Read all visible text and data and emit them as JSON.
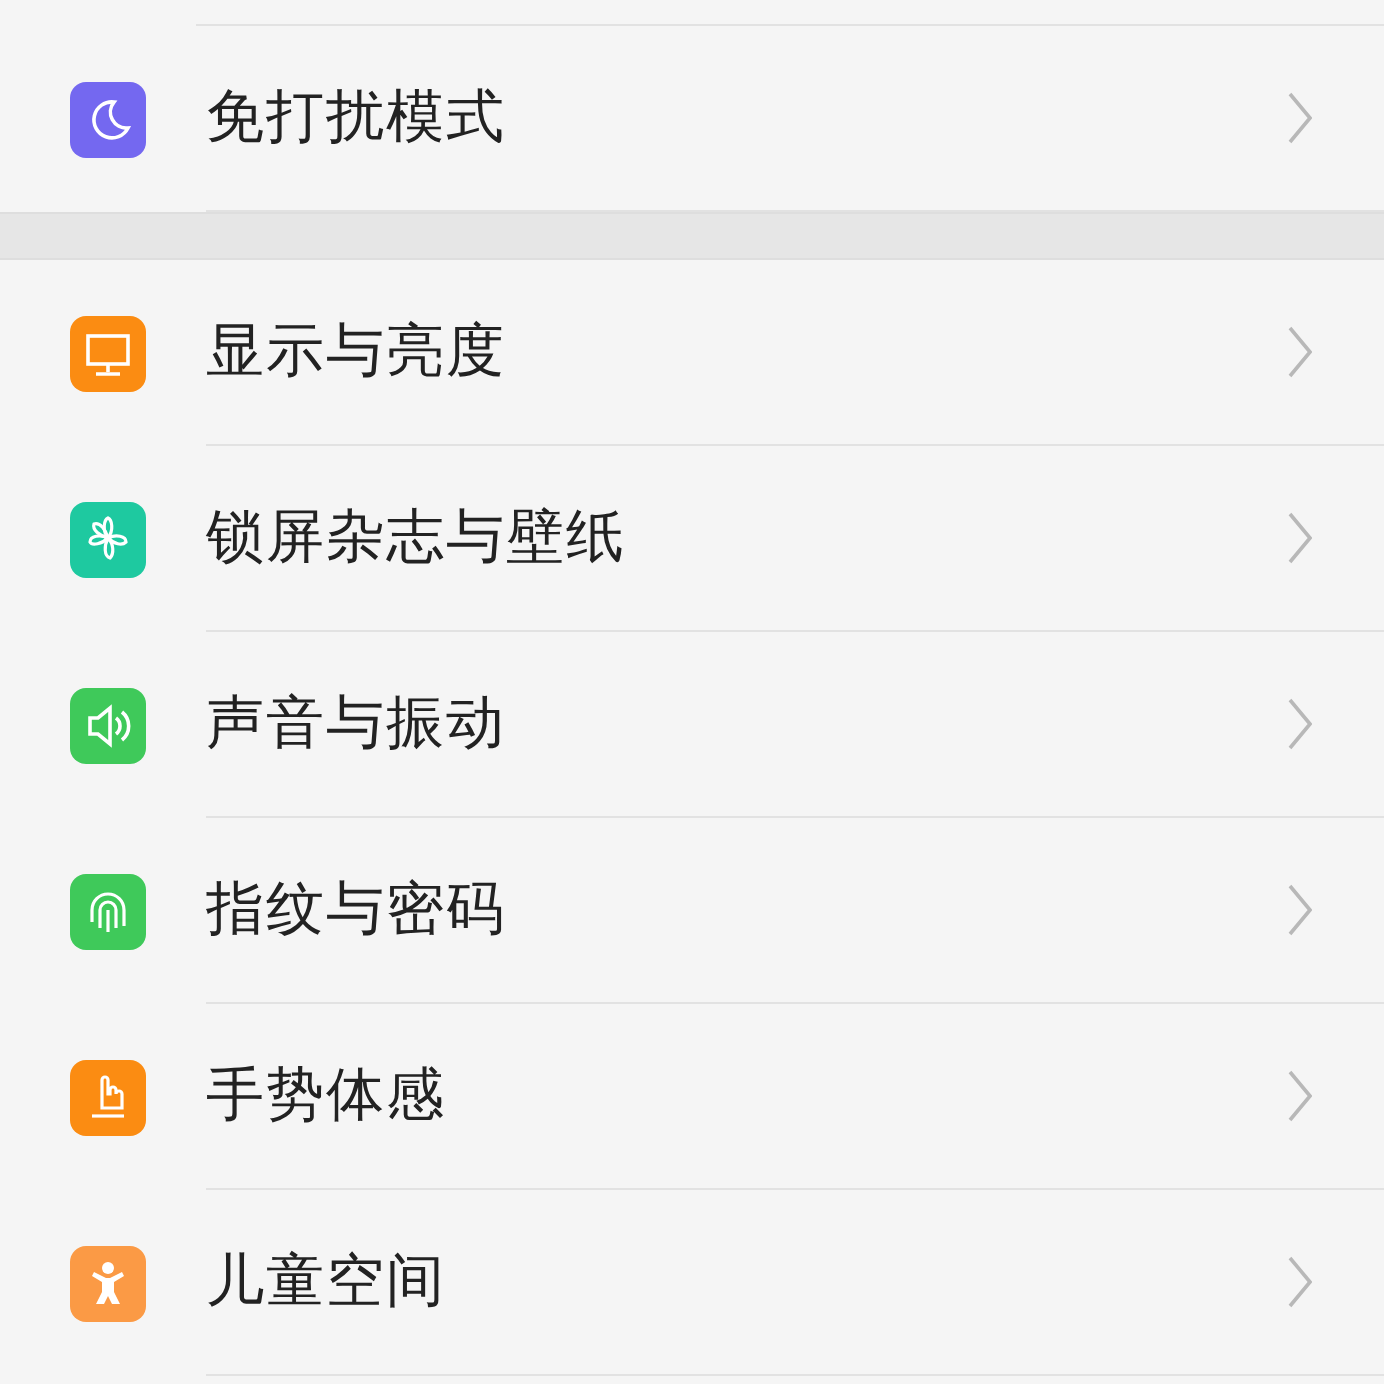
{
  "sections": [
    {
      "items": [
        {
          "label": "免打扰模式",
          "kind": "moon",
          "color": "#7468f0"
        }
      ]
    },
    {
      "items": [
        {
          "label": "显示与亮度",
          "kind": "monitor",
          "color": "#fb8c12"
        },
        {
          "label": "锁屏杂志与壁纸",
          "kind": "flower",
          "color": "#1ec9a0"
        },
        {
          "label": "声音与振动",
          "kind": "speaker",
          "color": "#3fc95a"
        },
        {
          "label": "指纹与密码",
          "kind": "fingerprint",
          "color": "#3fc95a"
        },
        {
          "label": "手势体感",
          "kind": "hand",
          "color": "#fb8c12"
        },
        {
          "label": "儿童空间",
          "kind": "child",
          "color": "#fb9a45"
        }
      ]
    }
  ]
}
